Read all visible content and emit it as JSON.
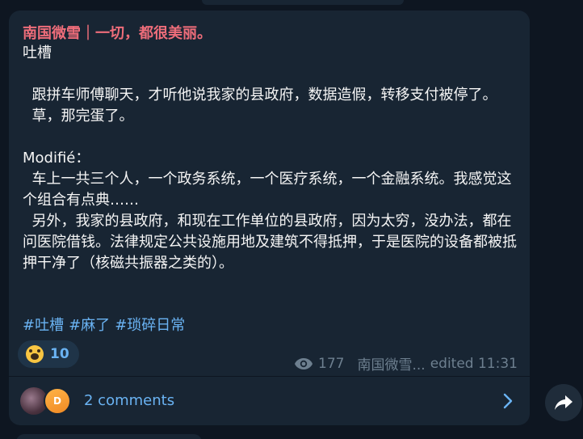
{
  "post": {
    "channel_name": "南国微雪｜一切，都很美丽。",
    "text": "吐槽\n\n  跟拼车师傅聊天，才听他说我家的县政府，数据造假，转移支付被停了。\n  草，那完蛋了。\n\nModifié：\n  车上一共三个人，一个政务系统，一个医疗系统，一个金融系统。我感觉这个组合有点典……\n  另外，我家的县政府，和现在工作单位的县政府，因为太穷，没办法，都在问医院借钱。法律规定公共设施用地及建筑不得抵押，于是医院的设备都被抵押干净了（核磁共振器之类的）。",
    "hashtags": [
      "#吐槽",
      "#麻了",
      "#琐碎日常"
    ],
    "reaction": {
      "emoji": "scream-emoji",
      "count": "10"
    },
    "views": "177",
    "author": "南国微雪...",
    "edited": "edited 11:31"
  },
  "comments": {
    "avatar_2_initial": "D",
    "label": "2 comments"
  },
  "icons": {
    "eye": "eye-icon",
    "chevron": "chevron-right-icon",
    "share": "share-arrow-icon"
  },
  "colors": {
    "background": "#0e1621",
    "bubble": "#182533",
    "channel_name": "#ee6d7a",
    "link": "#6ab3f3",
    "meta": "#6d7f8f"
  }
}
